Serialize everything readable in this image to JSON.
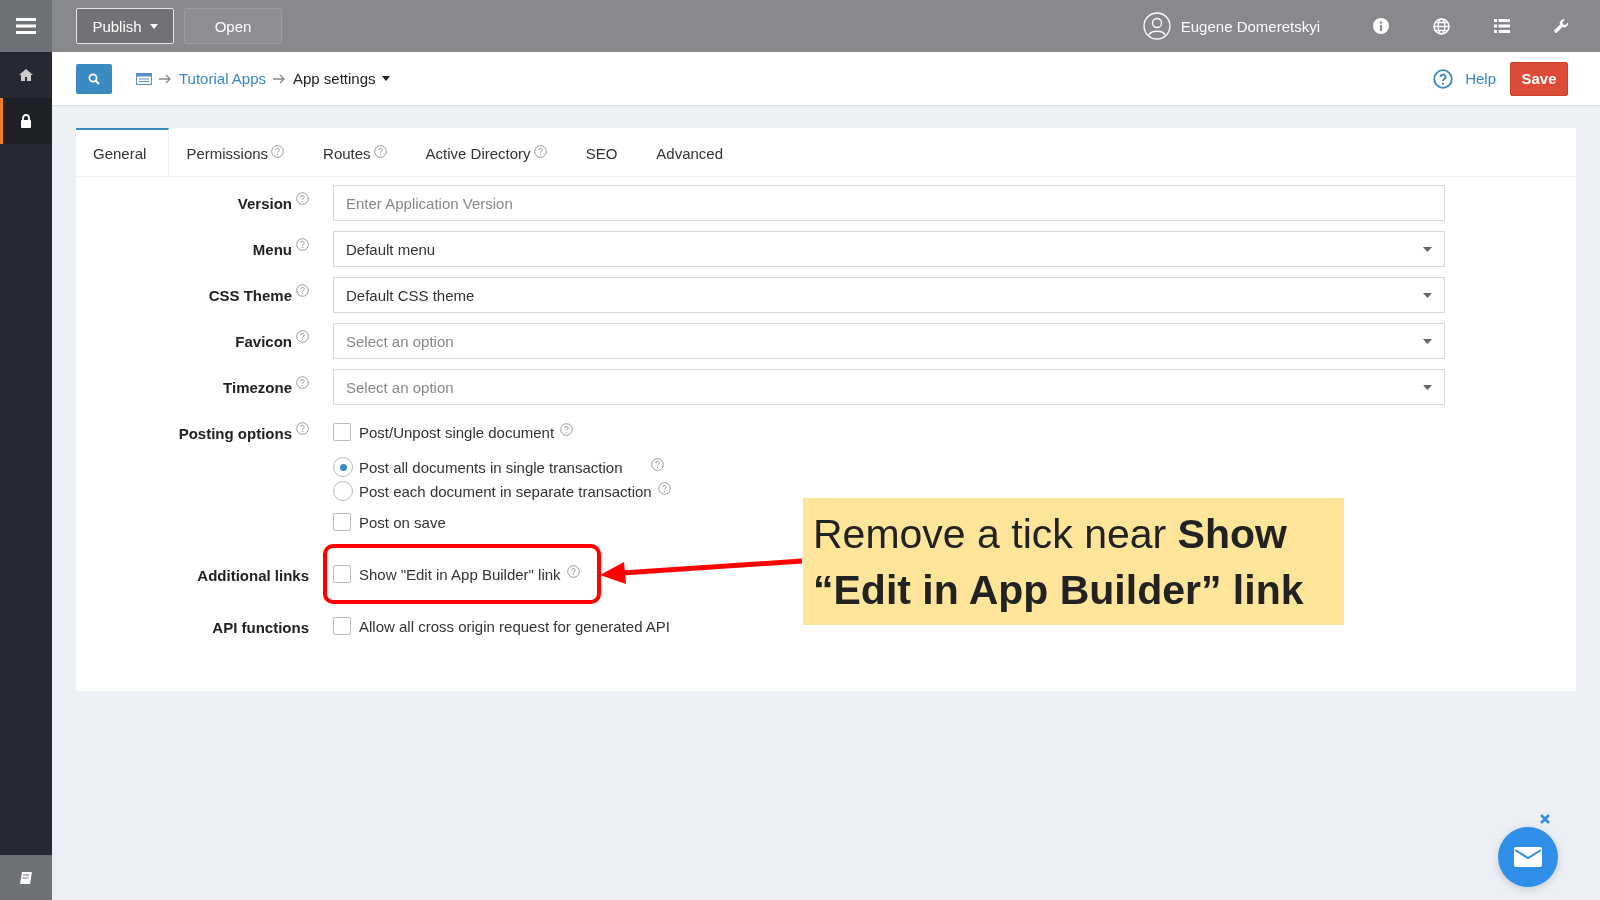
{
  "top_bar": {
    "buttons": [
      {
        "label": "Publish",
        "kind": "split"
      },
      {
        "label": "Open",
        "kind": "plain"
      }
    ],
    "user": {
      "name": "Eugene Domeretskyi"
    }
  },
  "sidebar": {
    "items": [
      {
        "kind": "home",
        "selected": false
      },
      {
        "kind": "lock",
        "selected": true
      }
    ]
  },
  "breadcrumb": {
    "items": [
      {
        "label": "Tutorial Apps",
        "kind": "link"
      },
      {
        "label": "App settings",
        "kind": "menu"
      }
    ]
  },
  "actions": {
    "help": "Help",
    "save": "Save"
  },
  "tabs": [
    {
      "label": "General",
      "selected": true,
      "help": false
    },
    {
      "label": "Permissions",
      "selected": false,
      "help": true
    },
    {
      "label": "Routes",
      "selected": false,
      "help": true
    },
    {
      "label": "Active Directory",
      "selected": false,
      "help": true
    },
    {
      "label": "SEO",
      "selected": false,
      "help": false
    },
    {
      "label": "Advanced",
      "selected": false,
      "help": false
    }
  ],
  "fields": [
    {
      "label": "Version",
      "help": true,
      "kind": "input",
      "placeholder": "Enter Application Version"
    },
    {
      "label": "Menu",
      "help": true,
      "kind": "select",
      "value": "Default menu"
    },
    {
      "label": "CSS Theme",
      "help": true,
      "kind": "select",
      "value": "Default CSS theme"
    },
    {
      "label": "Favicon",
      "help": true,
      "kind": "select",
      "placeholder": "Select an option"
    },
    {
      "label": "Timezone",
      "help": true,
      "kind": "select",
      "placeholder": "Select an option"
    },
    {
      "label": "Posting options",
      "help": true,
      "kind": "options",
      "options": [
        {
          "kind": "checkbox",
          "label": "Post/Unpost single document",
          "checked": false,
          "help": true
        },
        {
          "kind": "radio",
          "label": "Post all documents in single transaction",
          "selected": true,
          "help": true
        },
        {
          "kind": "radio",
          "label": "Post each document in separate transaction",
          "selected": false,
          "help": true
        },
        {
          "kind": "checkbox",
          "label": "Post on save",
          "checked": false,
          "help": false
        }
      ]
    },
    {
      "label": "Additional links",
      "help": false,
      "kind": "options",
      "options": [
        {
          "kind": "checkbox",
          "label": "Show \"Edit in App Builder\" link",
          "checked": false,
          "help": true,
          "highlighted": true
        }
      ]
    },
    {
      "label": "API functions",
      "help": false,
      "kind": "options",
      "options": [
        {
          "kind": "checkbox",
          "label": "Allow all cross origin request for generated API",
          "checked": false,
          "help": false
        }
      ]
    }
  ],
  "callout": {
    "text": "Remove a tick near **Show “Edit in App Builder” link**"
  }
}
